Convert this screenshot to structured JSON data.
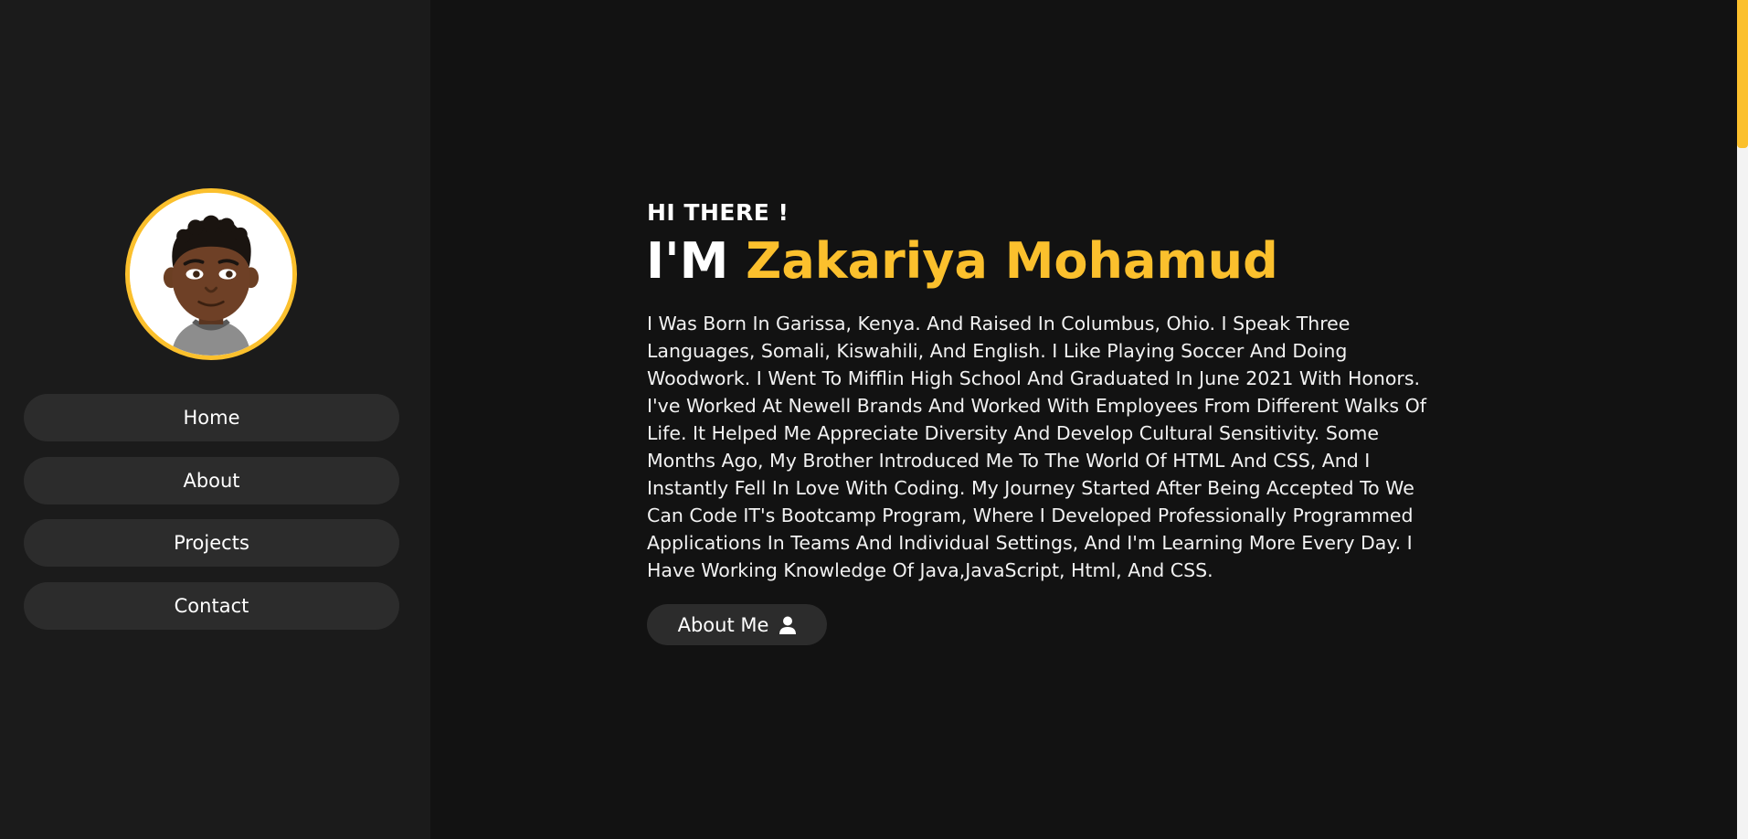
{
  "colors": {
    "accent": "#fbc02d",
    "sidebar_bg": "#1b1b1b",
    "main_bg": "#121212",
    "button_bg": "#2c2c2c",
    "text": "#ffffff"
  },
  "sidebar": {
    "avatar_icon": "person-avatar-icon",
    "nav": [
      {
        "label": "Home"
      },
      {
        "label": "About"
      },
      {
        "label": "Projects"
      },
      {
        "label": "Contact"
      }
    ]
  },
  "hero": {
    "greeting": "HI THERE !",
    "title_prefix": "I'M ",
    "name": "Zakariya Mohamud",
    "bio": "I Was Born In Garissa, Kenya. And Raised In Columbus, Ohio. I Speak Three Languages, Somali, Kiswahili, And English. I Like Playing Soccer And Doing Woodwork. I Went To Mifflin High School And Graduated In June 2021 With Honors. I've Worked At Newell Brands And Worked With Employees From Different Walks Of Life. It Helped Me Appreciate Diversity And Develop Cultural Sensitivity. Some Months Ago, My Brother Introduced Me To The World Of HTML And CSS, And I Instantly Fell In Love With Coding. My Journey Started After Being Accepted To We Can Code IT's Bootcamp Program, Where I Developed Professionally Programmed Applications In Teams And Individual Settings, And I'm Learning More Every Day. I Have Working Knowledge Of Java,JavaScript, Html, And CSS.",
    "about_button": {
      "label": "About Me",
      "icon": "user-icon"
    }
  },
  "scrollbar": {
    "position_fraction": 0.0
  }
}
